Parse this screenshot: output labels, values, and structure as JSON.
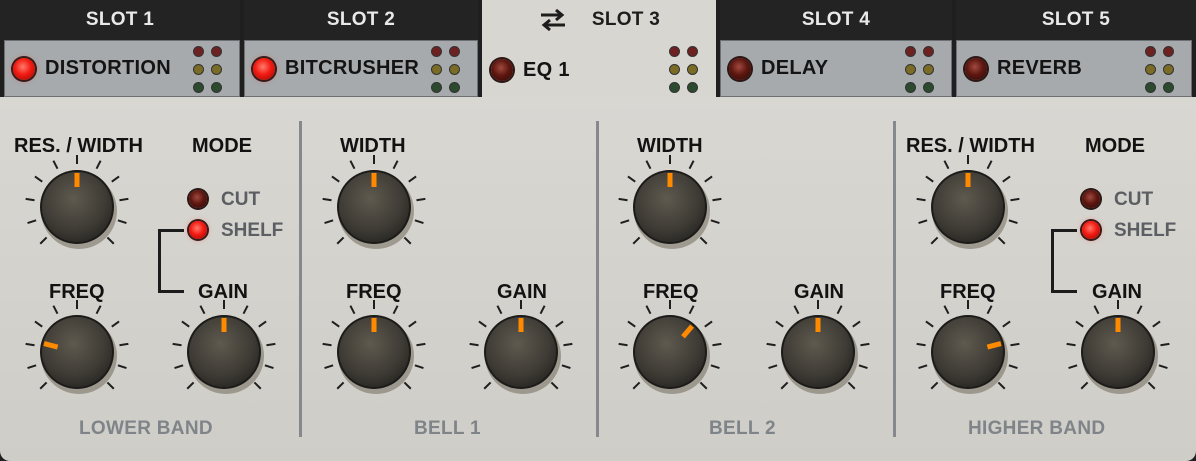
{
  "tabs": [
    {
      "label": "SLOT 1",
      "active": false
    },
    {
      "label": "SLOT 2",
      "active": false
    },
    {
      "label": "SLOT 3",
      "active": true
    },
    {
      "label": "SLOT 4",
      "active": false
    },
    {
      "label": "SLOT 5",
      "active": false
    }
  ],
  "slots": [
    {
      "name": "DISTORTION",
      "enabled": true
    },
    {
      "name": "BITCRUSHER",
      "enabled": true
    },
    {
      "name": "EQ 1",
      "enabled": false
    },
    {
      "name": "DELAY",
      "enabled": false
    },
    {
      "name": "REVERB",
      "enabled": false
    }
  ],
  "bands": {
    "lower": {
      "title": "LOWER BAND",
      "res_width_label": "RES. / WIDTH",
      "mode_label": "MODE",
      "freq_label": "FREQ",
      "gain_label": "GAIN",
      "mode_cut": "CUT",
      "mode_shelf": "SHELF",
      "selected_mode": "SHELF",
      "res_width": 0.5,
      "freq": 0.22,
      "gain": 0.5
    },
    "bell1": {
      "title": "BELL 1",
      "width_label": "WIDTH",
      "freq_label": "FREQ",
      "gain_label": "GAIN",
      "width": 0.5,
      "freq": 0.5,
      "gain": 0.5
    },
    "bell2": {
      "title": "BELL 2",
      "width_label": "WIDTH",
      "freq_label": "FREQ",
      "gain_label": "GAIN",
      "width": 0.5,
      "freq": 0.65,
      "gain": 0.5
    },
    "higher": {
      "title": "HIGHER BAND",
      "res_width_label": "RES. / WIDTH",
      "mode_label": "MODE",
      "freq_label": "FREQ",
      "gain_label": "GAIN",
      "mode_cut": "CUT",
      "mode_shelf": "SHELF",
      "selected_mode": "SHELF",
      "res_width": 0.5,
      "freq": 0.78,
      "gain": 0.5
    }
  },
  "icons": {
    "swap": "swap-arrows-icon"
  },
  "colors": {
    "led_on": "#f21a12",
    "indicator": "#ff8a00"
  }
}
